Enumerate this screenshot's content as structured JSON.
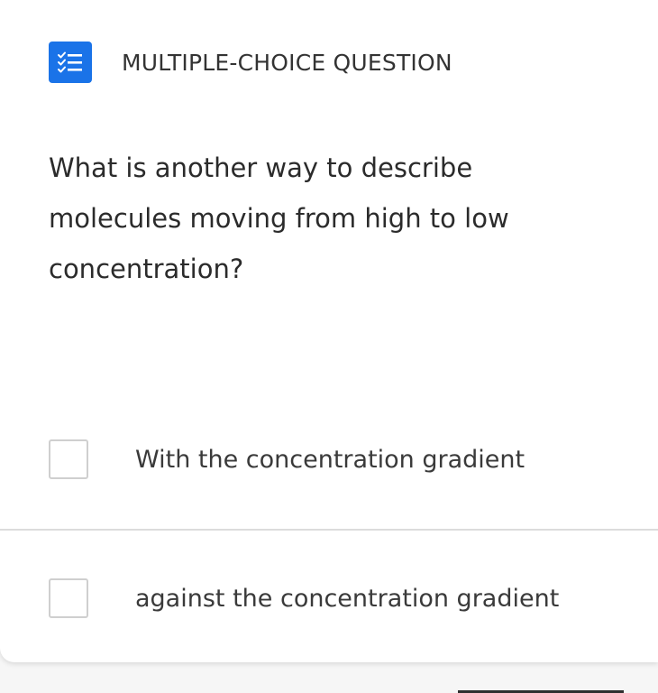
{
  "header": {
    "type_label": "MULTIPLE-CHOICE QUESTION",
    "icon": "checklist-icon",
    "accent_color": "#1a73e8"
  },
  "question": {
    "text": "What is another way to describe molecules moving from high to low concentration?"
  },
  "options": [
    {
      "label": "With the concentration gradient",
      "checked": false
    },
    {
      "label": "against the concentration gradient",
      "checked": false
    }
  ]
}
